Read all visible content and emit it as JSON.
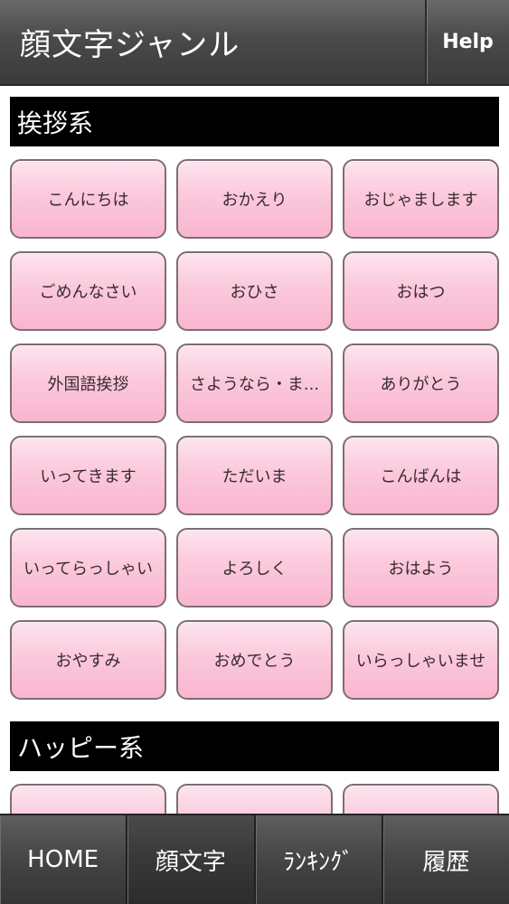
{
  "header": {
    "title": "顔文字ジャンル",
    "help_label": "Help"
  },
  "sections": [
    {
      "title": "挨拶系",
      "buttons": [
        "こんにちは",
        "おかえり",
        "おじゃまします",
        "ごめんなさい",
        "おひさ",
        "おはつ",
        "外国語挨拶",
        "さようなら・ま...",
        "ありがとう",
        "いってきます",
        "ただいま",
        "こんばんは",
        "いってらっしゃい",
        "よろしく",
        "おはよう",
        "おやすみ",
        "おめでとう",
        "いらっしゃいませ"
      ]
    },
    {
      "title": "ハッピー系",
      "buttons": [
        "",
        "",
        ""
      ]
    }
  ],
  "nav": {
    "tabs": [
      {
        "label": "HOME",
        "active": false
      },
      {
        "label": "顔文字",
        "active": true
      },
      {
        "label": "ﾗﾝｷﾝｸﾞ",
        "active": false
      },
      {
        "label": "履歴",
        "active": false
      }
    ]
  },
  "colors": {
    "button_pink": "#fbc9dc",
    "header_bar": "#4a4a4a",
    "section_header": "#000000"
  }
}
